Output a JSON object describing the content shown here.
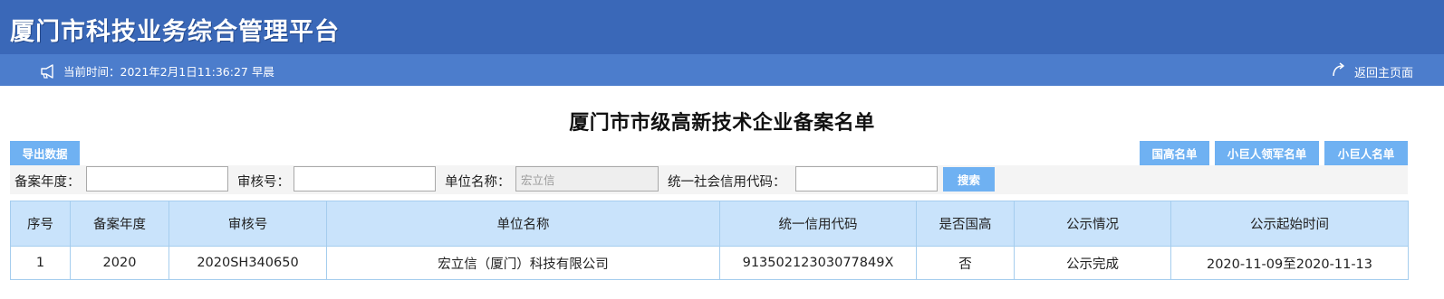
{
  "header": {
    "title": "厦门市科技业务综合管理平台",
    "time_text": "当前时间：2021年2月1日11:36:27 早晨",
    "home_link": "返回主页面"
  },
  "page": {
    "heading": "厦门市市级高新技术企业备案名单"
  },
  "toolbar": {
    "export_label": "导出数据",
    "right_buttons": [
      "国高名单",
      "小巨人领军名单",
      "小巨人名单"
    ]
  },
  "filters": {
    "year_label": "备案年度：",
    "year_value": "",
    "audit_label": "审核号：",
    "audit_value": "",
    "unit_label": "单位名称：",
    "unit_value": "宏立信",
    "credit_label": "统一社会信用代码：",
    "credit_value": "",
    "search_label": "搜索"
  },
  "table": {
    "columns": [
      "序号",
      "备案年度",
      "审核号",
      "单位名称",
      "统一信用代码",
      "是否国高",
      "公示情况",
      "公示起始时间"
    ],
    "rows": [
      [
        "1",
        "2020",
        "2020SH340650",
        "宏立信（厦门）科技有限公司",
        "91350212303077849X",
        "否",
        "公示完成",
        "2020-11-09至2020-11-13"
      ]
    ]
  },
  "colors": {
    "banner": "#3a68b8",
    "subbar": "#4c7dcc",
    "button": "#6fb1f2",
    "table_header": "#c9e3fb"
  },
  "icons": {
    "time": "megaphone-icon",
    "home": "return-arrow-icon"
  }
}
